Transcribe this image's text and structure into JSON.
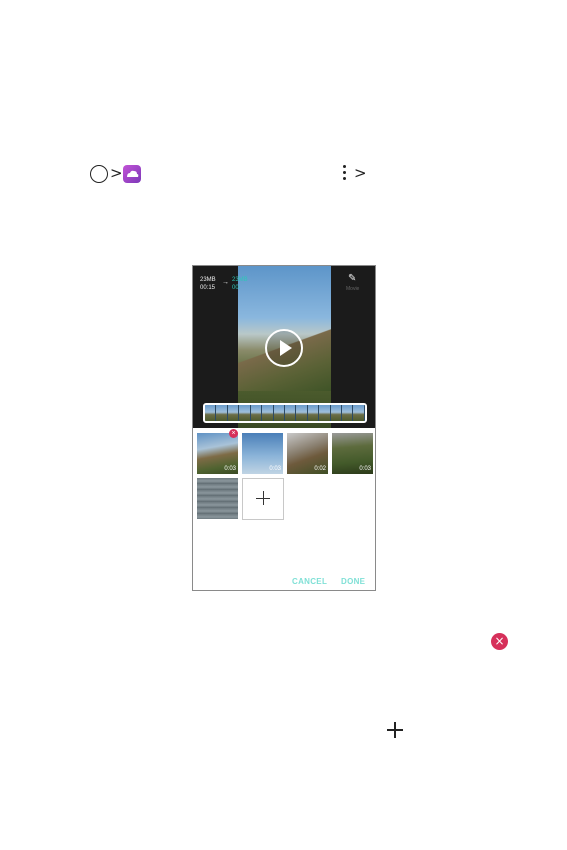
{
  "breadcrumb": {
    "home_icon": "home-circle-icon",
    "gallery_icon": "gallery-icon",
    "more_icon": "more-vertical-icon",
    "separator": ">"
  },
  "phone_screen": {
    "size_original": "23MB",
    "duration_original": "00:15",
    "size_new": "23MB",
    "duration_new": "00:",
    "arrow": "→",
    "magic_icon": "magic-wand-icon",
    "magic_label": "Movie",
    "clips": [
      {
        "duration": "0:03"
      },
      {
        "duration": "0:03"
      },
      {
        "duration": "0:02"
      },
      {
        "duration": "0:03"
      },
      {
        "duration": ""
      }
    ],
    "add_icon": "plus-icon",
    "cancel_label": "CANCEL",
    "done_label": "DONE"
  },
  "inline_icons": {
    "delete": "delete-x-icon",
    "add": "plus-icon"
  },
  "colors": {
    "accent_teal": "#2ec7b8",
    "delete_red": "#d6305a",
    "gallery_purple": "#a447c9"
  }
}
